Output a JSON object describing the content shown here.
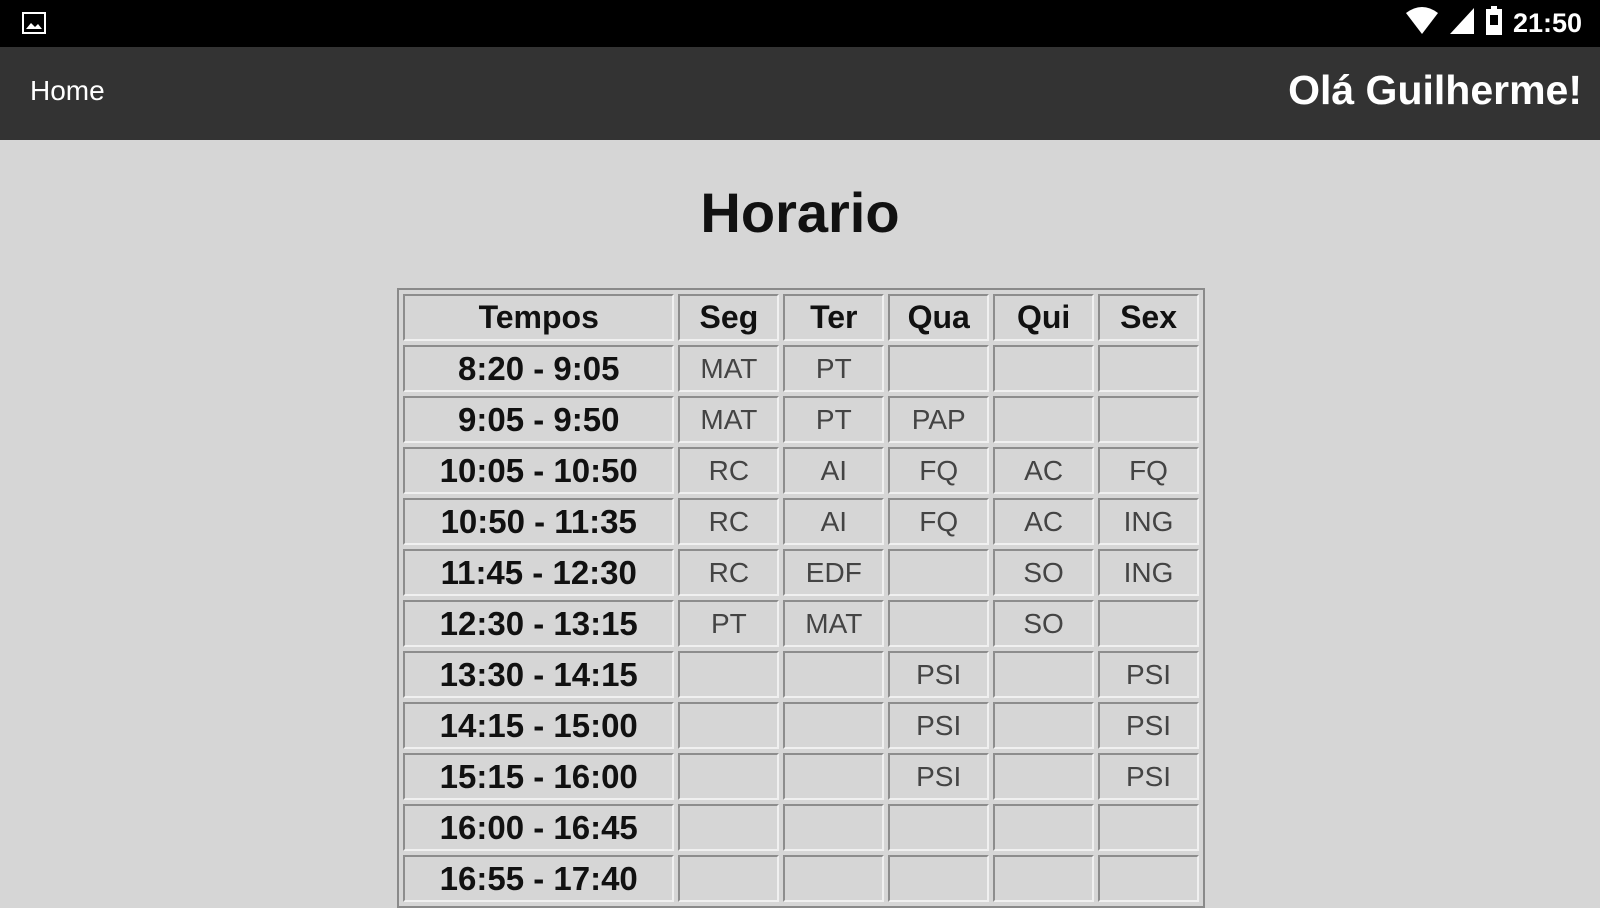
{
  "status_bar": {
    "time": "21:50",
    "icons": [
      "gallery-icon",
      "wifi-icon",
      "signal-icon",
      "battery-icon"
    ]
  },
  "app_bar": {
    "home_label": "Home",
    "greeting": "Olá Guilherme!"
  },
  "page": {
    "title": "Horario"
  },
  "schedule": {
    "headers": [
      "Tempos",
      "Seg",
      "Ter",
      "Qua",
      "Qui",
      "Sex"
    ],
    "rows": [
      {
        "time": "8:20 - 9:05",
        "cells": [
          "MAT",
          "PT",
          "",
          "",
          ""
        ]
      },
      {
        "time": "9:05 - 9:50",
        "cells": [
          "MAT",
          "PT",
          "PAP",
          "",
          ""
        ]
      },
      {
        "time": "10:05 - 10:50",
        "cells": [
          "RC",
          "AI",
          "FQ",
          "AC",
          "FQ"
        ]
      },
      {
        "time": "10:50 - 11:35",
        "cells": [
          "RC",
          "AI",
          "FQ",
          "AC",
          "ING"
        ]
      },
      {
        "time": "11:45 - 12:30",
        "cells": [
          "RC",
          "EDF",
          "",
          "SO",
          "ING"
        ]
      },
      {
        "time": "12:30 - 13:15",
        "cells": [
          "PT",
          "MAT",
          "",
          "SO",
          ""
        ]
      },
      {
        "time": "13:30 - 14:15",
        "cells": [
          "",
          "",
          "PSI",
          "",
          "PSI"
        ]
      },
      {
        "time": "14:15 - 15:00",
        "cells": [
          "",
          "",
          "PSI",
          "",
          "PSI"
        ]
      },
      {
        "time": "15:15 - 16:00",
        "cells": [
          "",
          "",
          "PSI",
          "",
          "PSI"
        ]
      },
      {
        "time": "16:00 - 16:45",
        "cells": [
          "",
          "",
          "",
          "",
          ""
        ]
      },
      {
        "time": "16:55 - 17:40",
        "cells": [
          "",
          "",
          "",
          "",
          ""
        ]
      }
    ]
  }
}
